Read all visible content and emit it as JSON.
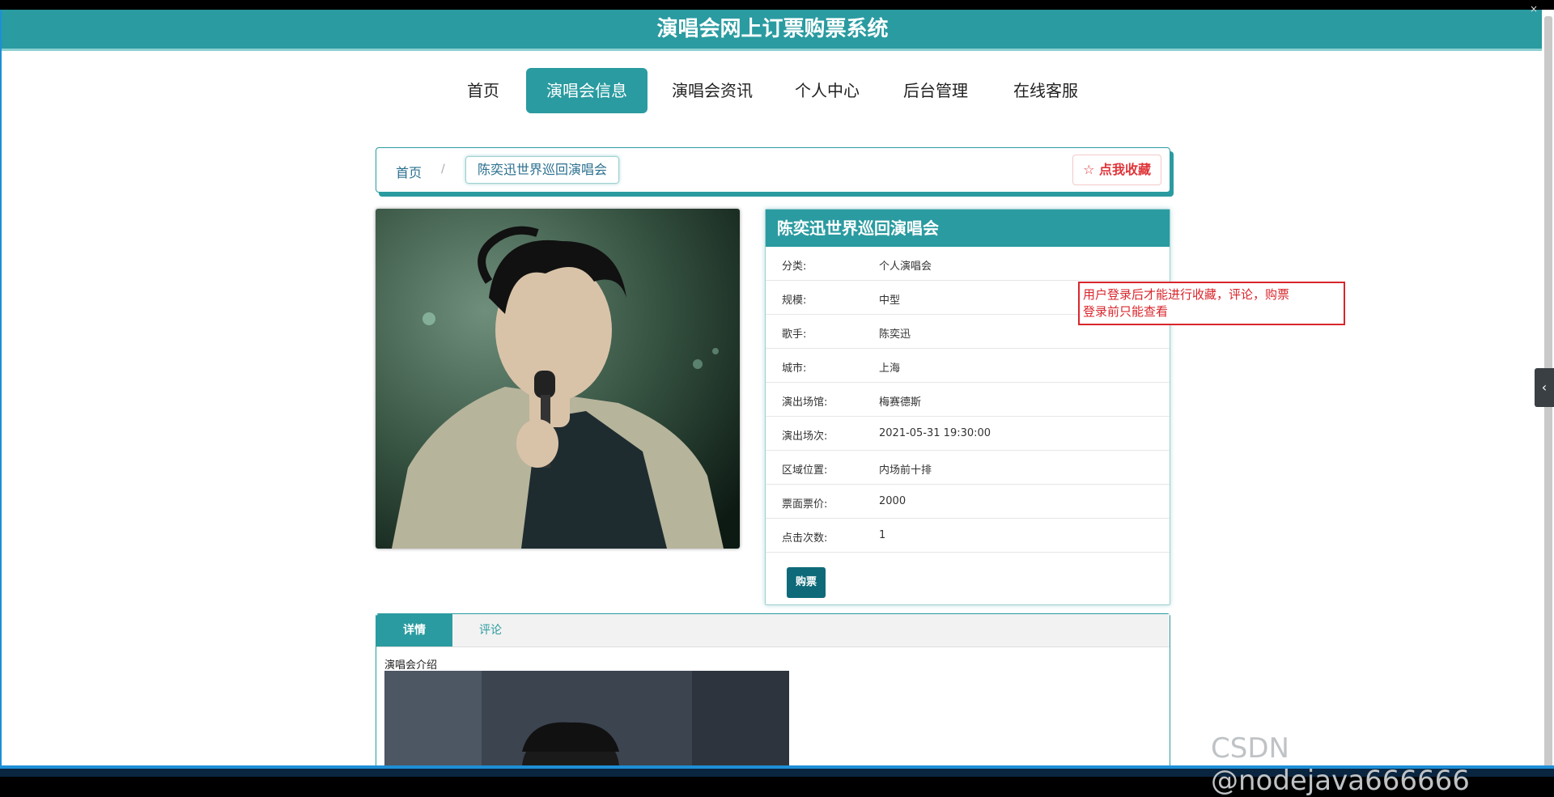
{
  "header": {
    "title": "演唱会网上订票购票系统"
  },
  "nav": {
    "items": [
      {
        "label": "首页"
      },
      {
        "label": "演唱会信息",
        "active": true
      },
      {
        "label": "演唱会资讯"
      },
      {
        "label": "个人中心"
      },
      {
        "label": "后台管理"
      },
      {
        "label": "在线客服"
      }
    ]
  },
  "breadcrumb": {
    "home": "首页",
    "separator": "/",
    "current": "陈奕迅世界巡回演唱会",
    "favorite_button": "☆ 点我收藏"
  },
  "detail": {
    "title": "陈奕迅世界巡回演唱会",
    "rows": [
      {
        "key": "分类:",
        "value": "个人演唱会"
      },
      {
        "key": "规模:",
        "value": "中型"
      },
      {
        "key": "歌手:",
        "value": "陈奕迅"
      },
      {
        "key": "城市:",
        "value": "上海"
      },
      {
        "key": "演出场馆:",
        "value": "梅赛德斯"
      },
      {
        "key": "演出场次:",
        "value": "2021-05-31 19:30:00"
      },
      {
        "key": "区域位置:",
        "value": "内场前十排"
      },
      {
        "key": "票面票价:",
        "value": "2000"
      },
      {
        "key": "点击次数:",
        "value": "1"
      }
    ],
    "buy_button": "购票"
  },
  "notice": {
    "line1": "用户登录后才能进行收藏，评论，购票",
    "line2": "登录前只能查看"
  },
  "tabs": {
    "items": [
      {
        "label": "详情",
        "active": true
      },
      {
        "label": "评论"
      }
    ],
    "intro_label": "演唱会介绍"
  },
  "side_handle": {
    "icon": "chevron-left-icon",
    "glyph": "‹"
  },
  "watermark": "CSDN @nodejava666666",
  "colors": {
    "primary": "#2a9ba0",
    "accent_red": "#d9262c",
    "buy": "#0e6a78"
  }
}
